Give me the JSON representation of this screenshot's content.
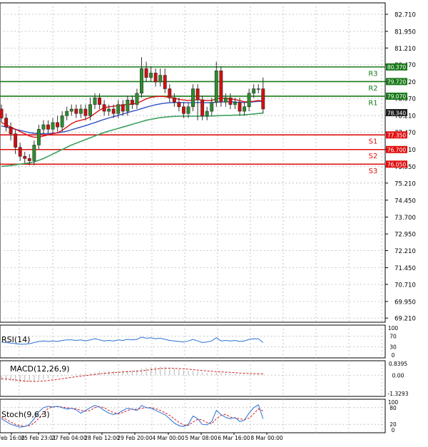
{
  "chart_data": {
    "type": "candlestick",
    "main": {
      "price_labels": [
        "82.710",
        "81.950",
        "81.210",
        "80.470",
        "79.720",
        "78.970",
        "78.210",
        "77.470",
        "76.710",
        "75.950",
        "75.210",
        "74.450",
        "73.700",
        "72.950",
        "72.210",
        "71.450",
        "70.710",
        "69.950",
        "69.210"
      ],
      "levels": [
        {
          "name": "R3",
          "value": 80.37,
          "label": "80.370",
          "color": "#1a7a1a"
        },
        {
          "name": "R2",
          "value": 79.72,
          "label": "79.720",
          "color": "#1a7a1a"
        },
        {
          "name": "R1",
          "value": 79.07,
          "label": "79.070",
          "color": "#1a7a1a"
        },
        {
          "name": "S1",
          "value": 77.35,
          "label": "77.350",
          "color": "#e01010"
        },
        {
          "name": "S2",
          "value": 76.7,
          "label": "76.700",
          "color": "#e01010"
        },
        {
          "name": "S3",
          "value": 76.05,
          "label": "76.050",
          "color": "#e01010"
        }
      ],
      "current_price": {
        "value": 78.34,
        "label": "78.340"
      },
      "candles": [
        [
          78.5,
          78.1,
          78.7,
          77.9
        ],
        [
          78.1,
          77.7,
          78.3,
          77.5
        ],
        [
          77.7,
          77.4,
          77.9,
          77.1
        ],
        [
          77.4,
          76.8,
          77.6,
          76.5
        ],
        [
          76.8,
          76.4,
          77.0,
          76.2
        ],
        [
          76.4,
          76.3,
          76.6,
          76.1
        ],
        [
          76.3,
          76.2,
          76.5,
          76.0
        ],
        [
          76.2,
          76.9,
          77.1,
          76.0
        ],
        [
          76.9,
          77.6,
          77.8,
          76.7
        ],
        [
          77.6,
          77.8,
          78.0,
          77.4
        ],
        [
          77.8,
          77.6,
          78.0,
          77.4
        ],
        [
          77.6,
          77.9,
          78.1,
          77.4
        ],
        [
          77.9,
          77.7,
          78.2,
          77.5
        ],
        [
          77.7,
          78.2,
          78.4,
          77.5
        ],
        [
          78.2,
          78.4,
          78.6,
          78.0
        ],
        [
          78.4,
          78.5,
          78.7,
          78.2
        ],
        [
          78.5,
          78.3,
          78.7,
          78.1
        ],
        [
          78.3,
          78.5,
          78.7,
          78.1
        ],
        [
          78.5,
          78.2,
          78.7,
          78.0
        ],
        [
          78.2,
          78.7,
          79.0,
          78.0
        ],
        [
          78.7,
          79.0,
          79.2,
          78.5
        ],
        [
          79.0,
          78.7,
          79.2,
          78.5
        ],
        [
          78.7,
          78.4,
          78.9,
          78.2
        ],
        [
          78.4,
          78.5,
          78.7,
          78.2
        ],
        [
          78.5,
          78.3,
          78.7,
          78.1
        ],
        [
          78.3,
          78.7,
          78.9,
          78.1
        ],
        [
          78.7,
          78.4,
          78.9,
          78.2
        ],
        [
          78.4,
          78.9,
          79.1,
          78.2
        ],
        [
          78.9,
          78.7,
          79.1,
          78.5
        ],
        [
          78.7,
          79.2,
          79.4,
          78.5
        ],
        [
          79.2,
          80.3,
          80.8,
          79.0
        ],
        [
          80.3,
          79.9,
          80.6,
          79.7
        ],
        [
          79.9,
          80.1,
          80.4,
          79.7
        ],
        [
          80.1,
          79.7,
          80.3,
          79.5
        ],
        [
          79.7,
          80.0,
          80.3,
          79.5
        ],
        [
          80.0,
          79.4,
          80.3,
          79.2
        ],
        [
          79.4,
          79.0,
          79.6,
          78.8
        ],
        [
          79.0,
          78.8,
          79.2,
          78.6
        ],
        [
          78.8,
          78.6,
          79.0,
          78.4
        ],
        [
          78.6,
          78.3,
          78.8,
          78.1
        ],
        [
          78.3,
          78.6,
          78.8,
          78.1
        ],
        [
          78.6,
          79.4,
          79.6,
          78.4
        ],
        [
          79.4,
          78.9,
          79.6,
          78.0
        ],
        [
          78.9,
          78.2,
          79.1,
          78.0
        ],
        [
          78.2,
          78.4,
          78.6,
          78.0
        ],
        [
          78.4,
          78.8,
          79.0,
          78.2
        ],
        [
          78.8,
          80.2,
          80.6,
          78.6
        ],
        [
          80.2,
          78.8,
          80.4,
          78.6
        ],
        [
          78.8,
          79.0,
          79.2,
          78.6
        ],
        [
          79.0,
          78.7,
          79.2,
          78.5
        ],
        [
          78.7,
          78.8,
          79.0,
          78.5
        ],
        [
          78.8,
          78.4,
          79.0,
          78.2
        ],
        [
          78.4,
          78.6,
          78.8,
          78.2
        ],
        [
          78.6,
          79.2,
          79.4,
          78.4
        ],
        [
          79.2,
          79.4,
          79.6,
          79.0
        ],
        [
          79.4,
          79.4,
          79.6,
          79.2
        ],
        [
          79.4,
          78.5,
          79.9,
          78.3
        ]
      ],
      "ma_red": [
        77.9,
        77.8,
        77.7,
        77.6,
        77.5,
        77.4,
        77.3,
        77.25,
        77.25,
        77.3,
        77.35,
        77.4,
        77.45,
        77.55,
        77.7,
        77.85,
        77.95,
        78.0,
        78.05,
        78.15,
        78.3,
        78.45,
        78.55,
        78.6,
        78.62,
        78.65,
        78.68,
        78.7,
        78.72,
        78.75,
        78.85,
        78.95,
        79.02,
        79.05,
        79.06,
        79.05,
        79.02,
        78.98,
        78.93,
        78.9,
        78.88,
        78.9,
        78.92,
        78.9,
        78.88,
        78.88,
        78.95,
        78.98,
        78.97,
        78.95,
        78.92,
        78.88,
        78.82,
        78.82,
        78.85,
        78.88,
        78.85
      ],
      "ma_blue": [
        77.75,
        77.7,
        77.65,
        77.6,
        77.55,
        77.5,
        77.45,
        77.42,
        77.4,
        77.4,
        77.4,
        77.42,
        77.44,
        77.47,
        77.52,
        77.58,
        77.64,
        77.7,
        77.76,
        77.83,
        77.9,
        77.97,
        78.04,
        78.1,
        78.16,
        78.22,
        78.28,
        78.34,
        78.4,
        78.45,
        78.52,
        78.58,
        78.64,
        78.69,
        78.73,
        78.76,
        78.78,
        78.79,
        78.79,
        78.79,
        78.78,
        78.78,
        78.79,
        78.79,
        78.78,
        78.78,
        78.8,
        78.82,
        78.82,
        78.82,
        78.81,
        78.8,
        78.79,
        78.8,
        78.82,
        78.84,
        78.84
      ],
      "ma_green": [
        75.95,
        75.97,
        75.99,
        76.02,
        76.05,
        76.08,
        76.11,
        76.15,
        76.22,
        76.3,
        76.4,
        76.5,
        76.6,
        76.7,
        76.8,
        76.9,
        76.98,
        77.06,
        77.14,
        77.22,
        77.3,
        77.38,
        77.46,
        77.52,
        77.58,
        77.64,
        77.7,
        77.76,
        77.82,
        77.88,
        77.94,
        78.0,
        78.04,
        78.08,
        78.12,
        78.14,
        78.16,
        78.17,
        78.18,
        78.18,
        78.18,
        78.18,
        78.18,
        78.18,
        78.18,
        78.19,
        78.2,
        78.21,
        78.22,
        78.22,
        78.23,
        78.23,
        78.24,
        78.26,
        78.28,
        78.3,
        78.32
      ]
    },
    "rsi": {
      "title": "RSI(14)",
      "labels": [
        "100",
        "70",
        "30",
        "0"
      ],
      "values": [
        48,
        46,
        44,
        42,
        40,
        40,
        42,
        46,
        50,
        52,
        50,
        52,
        50,
        54,
        56,
        56,
        54,
        56,
        52,
        56,
        60,
        56,
        52,
        54,
        52,
        56,
        54,
        58,
        56,
        58,
        66,
        62,
        64,
        60,
        62,
        58,
        54,
        52,
        50,
        48,
        52,
        58,
        52,
        46,
        48,
        52,
        64,
        52,
        54,
        52,
        54,
        50,
        52,
        58,
        60,
        60,
        46
      ]
    },
    "macd": {
      "title": "MACD(12,26,9)",
      "labels": [
        "0.8395",
        "0.00",
        "-1.3293"
      ],
      "histogram": [
        -0.35,
        -0.38,
        -0.42,
        -0.46,
        -0.5,
        -0.52,
        -0.5,
        -0.45,
        -0.38,
        -0.3,
        -0.24,
        -0.18,
        -0.12,
        -0.06,
        0.0,
        0.04,
        0.08,
        0.1,
        0.12,
        0.15,
        0.2,
        0.26,
        0.28,
        0.3,
        0.3,
        0.31,
        0.32,
        0.34,
        0.35,
        0.38,
        0.48,
        0.55,
        0.6,
        0.62,
        0.63,
        0.6,
        0.54,
        0.48,
        0.42,
        0.36,
        0.32,
        0.3,
        0.26,
        0.2,
        0.16,
        0.14,
        0.18,
        0.16,
        0.14,
        0.12,
        0.1,
        0.07,
        0.05,
        0.06,
        0.08,
        0.1,
        0.08
      ],
      "signal": [
        -0.25,
        -0.28,
        -0.31,
        -0.35,
        -0.39,
        -0.42,
        -0.44,
        -0.45,
        -0.44,
        -0.42,
        -0.39,
        -0.35,
        -0.31,
        -0.26,
        -0.21,
        -0.16,
        -0.11,
        -0.07,
        -0.03,
        0.01,
        0.05,
        0.09,
        0.13,
        0.16,
        0.19,
        0.21,
        0.23,
        0.25,
        0.27,
        0.29,
        0.32,
        0.36,
        0.4,
        0.44,
        0.48,
        0.5,
        0.51,
        0.5,
        0.48,
        0.46,
        0.43,
        0.4,
        0.37,
        0.34,
        0.31,
        0.28,
        0.26,
        0.24,
        0.22,
        0.2,
        0.18,
        0.16,
        0.14,
        0.12,
        0.11,
        0.1,
        0.1
      ]
    },
    "stoch": {
      "title": "Stoch(9,6,3)",
      "labels": [
        "100",
        "80",
        "20",
        "0"
      ],
      "k": [
        40,
        30,
        20,
        15,
        10,
        12,
        20,
        40,
        65,
        80,
        85,
        82,
        85,
        80,
        75,
        78,
        72,
        60,
        70,
        80,
        88,
        82,
        70,
        60,
        55,
        60,
        70,
        78,
        74,
        70,
        88,
        80,
        78,
        70,
        62,
        55,
        40,
        25,
        15,
        12,
        20,
        50,
        40,
        20,
        18,
        30,
        70,
        55,
        45,
        40,
        45,
        30,
        35,
        60,
        80,
        90,
        40
      ],
      "d": [
        45,
        38,
        28,
        20,
        15,
        13,
        15,
        25,
        42,
        62,
        77,
        83,
        84,
        82,
        80,
        78,
        76,
        70,
        67,
        70,
        80,
        84,
        80,
        70,
        62,
        58,
        62,
        70,
        75,
        74,
        78,
        80,
        80,
        76,
        70,
        62,
        52,
        40,
        27,
        18,
        16,
        28,
        38,
        36,
        26,
        22,
        40,
        52,
        56,
        46,
        43,
        40,
        37,
        42,
        58,
        76,
        68
      ]
    },
    "x_labels": [
      "Feb 16:00",
      "25 Feb 23:01",
      "27 Feb 04:00",
      "28 Feb 12:00",
      "29 Feb 20:00",
      "4 Mar 00:00",
      "5 Mar 08:00",
      "6 Mar 16:00",
      "8 Mar 00:00"
    ],
    "colors": {
      "bull": "#2e8b2e",
      "bear": "#cc1111",
      "ma_red": "#e01010",
      "ma_blue": "#3050c8",
      "ma_green": "#3ca060",
      "rsi_line": "#2a6fd6",
      "macd_hist": "#c0c0c0",
      "macd_signal": "#d02020",
      "stoch_k": "#2a6fd6",
      "stoch_d": "#d02020",
      "current_price_bg": "#1e1e1e",
      "grid": "#b9b9b9"
    }
  }
}
